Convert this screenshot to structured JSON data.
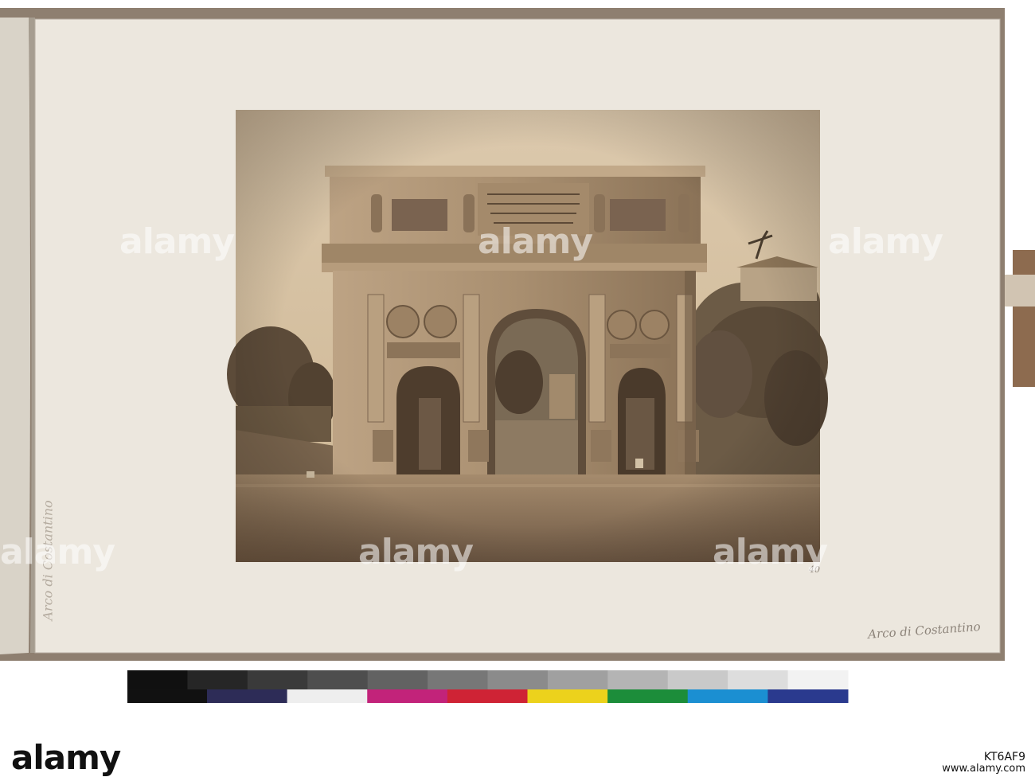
{
  "album": {
    "page_number": "40",
    "handwritten_caption": "Arco di Costantino",
    "spine_caption": "Arco di Costantino"
  },
  "watermark": {
    "logo": "alamy",
    "image_id": "KT6AF9",
    "url": "www.alamy.com"
  },
  "color_chart": {
    "grey_patches": [
      "#101010",
      "#262626",
      "#3a3a3a",
      "#4e4e4e",
      "#626262",
      "#777777",
      "#8b8b8b",
      "#a0a0a0",
      "#b4b4b4",
      "#c9c9c9",
      "#dddddd",
      "#f2f2f2"
    ],
    "color_patches": [
      "#2d2c57",
      "#eeeeee",
      "#c2237a",
      "#cf2335",
      "#ecd21c",
      "#1c8d3a",
      "#1b8fd2",
      "#2a3a8e"
    ]
  }
}
